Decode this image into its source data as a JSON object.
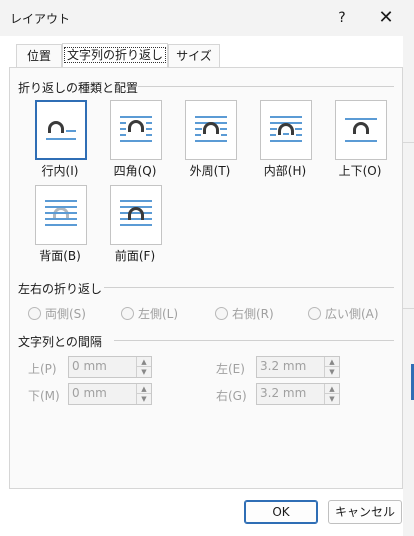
{
  "window": {
    "title": "レイアウト",
    "help_glyph": "?",
    "close_glyph": "✕"
  },
  "tabs": [
    {
      "label": "位置",
      "active": false
    },
    {
      "label": "文字列の折り返し",
      "active": true
    },
    {
      "label": "サイズ",
      "active": false
    }
  ],
  "wrap_section": {
    "title": "折り返しの種類と配置",
    "items": [
      {
        "label": "行内(I)",
        "icon": "inline-with-text-icon",
        "selected": true
      },
      {
        "label": "四角(Q)",
        "icon": "square-wrap-icon",
        "selected": false
      },
      {
        "label": "外周(T)",
        "icon": "tight-wrap-icon",
        "selected": false
      },
      {
        "label": "内部(H)",
        "icon": "through-wrap-icon",
        "selected": false
      },
      {
        "label": "上下(O)",
        "icon": "top-bottom-wrap-icon",
        "selected": false
      },
      {
        "label": "背面(B)",
        "icon": "behind-text-icon",
        "selected": false
      },
      {
        "label": "前面(F)",
        "icon": "in-front-of-text-icon",
        "selected": false
      }
    ]
  },
  "side_section": {
    "title": "左右の折り返し",
    "options": [
      {
        "label": "両側(S)"
      },
      {
        "label": "左側(L)"
      },
      {
        "label": "右側(R)"
      },
      {
        "label": "広い側(A)"
      }
    ]
  },
  "distance_section": {
    "title": "文字列との間隔",
    "top": {
      "label": "上(P)",
      "value": "0 mm"
    },
    "bottom": {
      "label": "下(M)",
      "value": "0 mm"
    },
    "left": {
      "label": "左(E)",
      "value": "3.2 mm"
    },
    "right": {
      "label": "右(G)",
      "value": "3.2 mm"
    }
  },
  "buttons": {
    "ok": "OK",
    "cancel": "キャンセル"
  },
  "colors": {
    "accent": "#2f6eb5",
    "text_lines": "#5b9bd5",
    "shape_dark": "#3a3a3a",
    "shape_light": "#b0b8c0"
  }
}
